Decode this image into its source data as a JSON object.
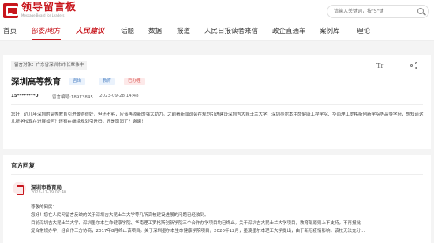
{
  "header": {
    "logo_title": "领导留言板",
    "logo_subtitle": "Message Board for Leaders",
    "search_placeholder": "请输入关键词，按\"S\"键"
  },
  "nav": {
    "items": [
      "首页",
      "部委/地方",
      "人民建议",
      "话题",
      "数据",
      "报道",
      "人民日报读者来信",
      "政企直通车",
      "案例库",
      "理论"
    ],
    "active": "部委/地方"
  },
  "question": {
    "target": "留言对象：广东省深圳市市长覃伟中",
    "font_icon": "Tr",
    "title": "深圳高等教育",
    "tags": [
      "咨询",
      "教育",
      "已办理"
    ],
    "user": "15********0",
    "id_label": "留言编号:18973845",
    "time": "2023-09-28 14:48",
    "body": "您好，近几年深圳的高等教育引进做得很好，但还不够，应该再添新的强大助力。之前看新闻说会在规划引进建设深圳吉大昆士兰大学、深圳墨尔本生命健康工程学院、华南理工罗格斯创新学院等高等学府，想知道这几所学校现在进展如何？还有在继续规划引进吗，还是取消了？谢谢！"
  },
  "reply": {
    "header": "官方回复",
    "org": "深圳市教育局",
    "time": "2023-11-19 07:40",
    "lines": [
      "尊敬的网民：",
      "您好！您在人民网留言反映的关于深圳吉大昆士兰大学等几所高校建设进展的问题已经收到。",
      "目前深圳吉大昆士兰大学、深圳墨尔本生命健康学院、华南理工罗格斯创新学院三个合作办学项目均已终止。关于深圳吉大昆士兰大学项目，教育部原则上不支持，不再报批",
      "复合常规办学，经合作三方协商，2017年8月终止该项目。关于深圳墨尔本生命健康学院项目，2020年12月，墨澳墨尔本理工大学提出，由于新冠疫情影响，该校无法充分..."
    ]
  },
  "colors": {
    "brand_red": "#c8161d",
    "tag_blue": "#4a7fc1",
    "tag_red": "#d9534f"
  }
}
